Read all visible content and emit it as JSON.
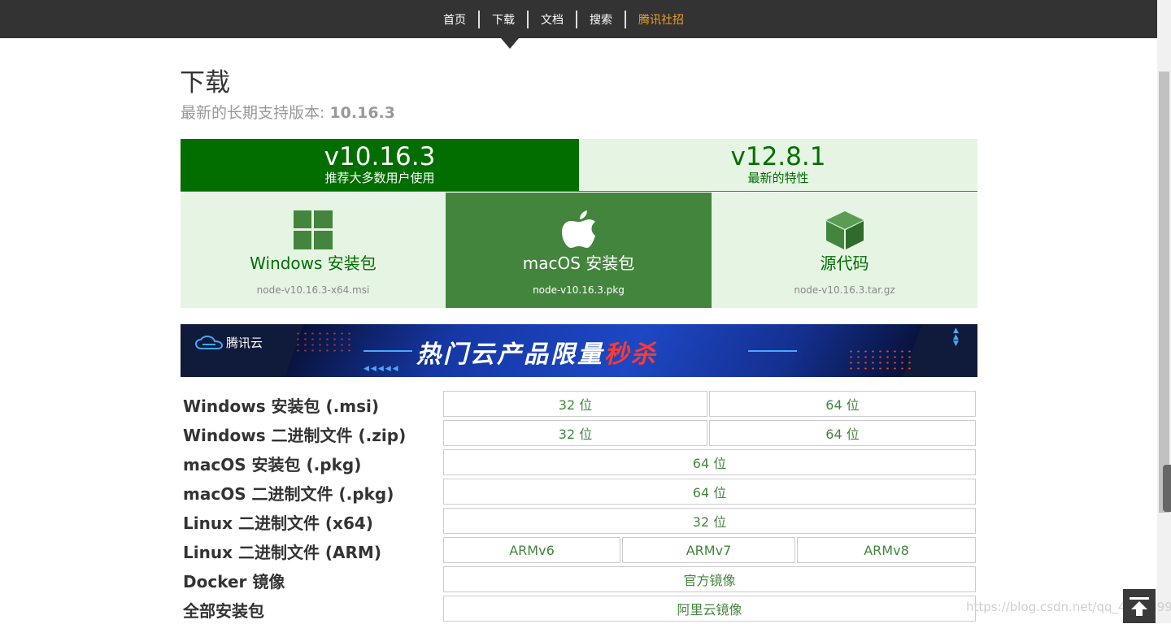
{
  "nav": {
    "items": [
      {
        "label": "首页"
      },
      {
        "label": "下载"
      },
      {
        "label": "文档"
      },
      {
        "label": "搜索"
      },
      {
        "label": "腾讯社招"
      }
    ],
    "highlight_color": "#f0a020"
  },
  "page": {
    "title": "下载",
    "lts_prefix": "最新的长期支持版本: ",
    "lts_version": "10.16.3"
  },
  "version_tabs": [
    {
      "version": "v10.16.3",
      "subtitle": "推荐大多数用户使用",
      "selected": true
    },
    {
      "version": "v12.8.1",
      "subtitle": "最新的特性",
      "selected": false
    }
  ],
  "download_cards": [
    {
      "icon": "windows-icon",
      "label": "Windows 安装包",
      "file": "node-v10.16.3-x64.msi"
    },
    {
      "icon": "apple-icon",
      "label": "macOS 安装包",
      "file": "node-v10.16.3.pkg"
    },
    {
      "icon": "source-box-icon",
      "label": "源代码",
      "file": "node-v10.16.3.tar.gz"
    }
  ],
  "banner": {
    "brand": "腾讯云",
    "promo_main": "热门云产品限量",
    "promo_hot": "秒杀"
  },
  "download_table": [
    {
      "label": "Windows 安装包 (.msi)",
      "cells": [
        "32 位",
        "64 位"
      ]
    },
    {
      "label": "Windows 二进制文件 (.zip)",
      "cells": [
        "32 位",
        "64 位"
      ]
    },
    {
      "label": "macOS 安装包 (.pkg)",
      "cells": [
        "64 位"
      ]
    },
    {
      "label": "macOS 二进制文件 (.pkg)",
      "cells": [
        "64 位"
      ]
    },
    {
      "label": "Linux 二进制文件 (x64)",
      "cells": [
        "32 位"
      ]
    },
    {
      "label": "Linux 二进制文件 (ARM)",
      "cells": [
        "ARMv6",
        "ARMv7",
        "ARMv8"
      ]
    },
    {
      "label": "Docker 镜像",
      "cells": [
        "官方镜像"
      ]
    },
    {
      "label": "全部安装包",
      "cells": [
        "阿里云镜像"
      ]
    }
  ],
  "watermark": "https://blog.csdn.net/qq_40128990",
  "colors": {
    "nav_bg": "#333333",
    "brand_dark_green": "#026e00",
    "brand_green": "#43853d",
    "light_green": "#e6f4e4"
  }
}
